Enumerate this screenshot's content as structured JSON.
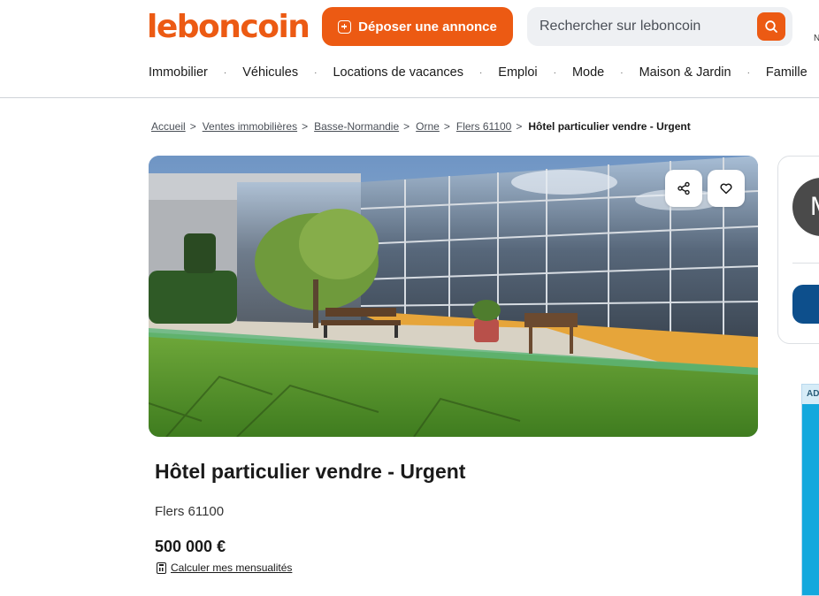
{
  "header": {
    "logo_text": "leboncoin",
    "post_button_label": "Déposer une annonce",
    "search_placeholder": "Rechercher sur leboncoin",
    "right_text": "N"
  },
  "nav": {
    "items": [
      "Immobilier",
      "Véhicules",
      "Locations de vacances",
      "Emploi",
      "Mode",
      "Maison & Jardin",
      "Famille"
    ],
    "separator": "·"
  },
  "breadcrumb": {
    "items": [
      "Accueil",
      "Ventes immobilières",
      "Basse-Normandie",
      "Orne",
      "Flers 61100"
    ],
    "separator": ">",
    "current": "Hôtel particulier vendre - Urgent"
  },
  "listing": {
    "title": "Hôtel particulier vendre - Urgent",
    "location": "Flers 61100",
    "price": "500 000 €",
    "calc_link": "Calculer mes mensualités"
  },
  "side": {
    "avatar_letter": "M",
    "ad_label": "AD"
  },
  "colors": {
    "brand": "#ec5a13",
    "side_button": "#0d4f8c",
    "ad_background": "#13a8dd"
  },
  "icons": {
    "share": "share-icon",
    "favorite": "heart-icon",
    "search": "search-icon",
    "post": "plus-square-icon",
    "calculator": "calculator-icon"
  }
}
